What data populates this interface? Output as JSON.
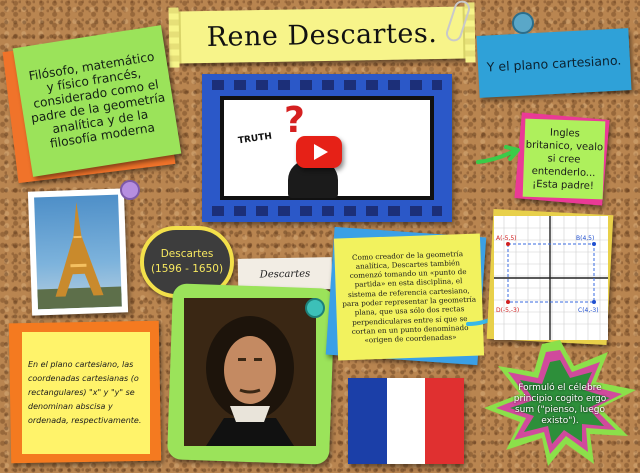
{
  "title": "Rene Descartes.",
  "intro_note": "Filósofo, matemático y físico francés, considerado como el padre de la geometría analítica y de la filosofía moderna",
  "plane_note": "Y el plano cartesiano.",
  "video": {
    "truth_label": "TRUTH",
    "question_mark": "?",
    "play_icon": "play-icon"
  },
  "english_note": "Ingles britanico, vealo si cree entenderlo... ¡Esta padre!",
  "descartes_label": "Descartes (1596 - 1650)",
  "signature_text": "Descartes",
  "yellow_note": "Como creador de la geometría analítica, Descartes también comenzó tomando un «punto de partida» en esta disciplina, el sistema de referencia cartesiano, para poder representar la geometría plana, que usa sólo dos rectas perpendiculares entre sí que se cortan en un punto denominado «origen de coordenadas»",
  "orange_note": "En el plano cartesiano, las coordenadas cartesianas (o rectangulares) \"x\" y \"y\" se denominan abscisa y ordenada, respectivamente.",
  "star_note": "Formuló el célebre principio cogito ergo sum (\"pienso, luego existo\").",
  "graph": {
    "labels": [
      "A(-5,5)",
      "B(4,5)",
      "C(4,-3)",
      "D(-5,-3)"
    ]
  },
  "colors": {
    "cork": "#b98550",
    "title_yellow": "#f7f48a",
    "intro_green": "#9be35a",
    "intro_orange": "#f0732a",
    "plane_blue": "#2fa1d8",
    "video_blue": "#2b58c8",
    "pink": "#ea3a96",
    "lime": "#aef05c",
    "note_yellow": "#f2f25e",
    "flag": [
      "#1b3fa8",
      "#ffffff",
      "#e03030"
    ],
    "star_green": "#8be04a",
    "star_pink": "#d04a9c",
    "star_dark": "#2d8f3a"
  }
}
